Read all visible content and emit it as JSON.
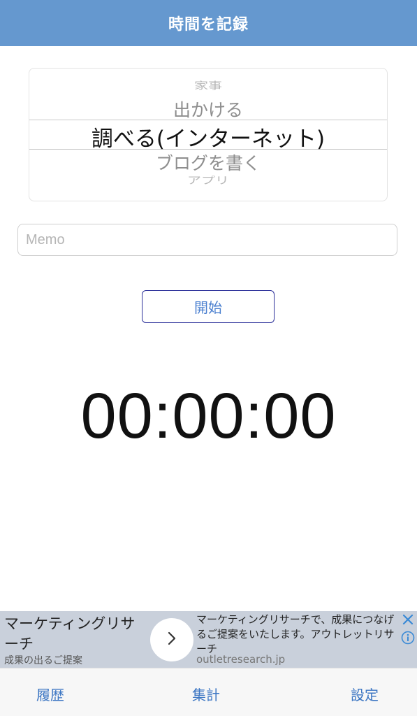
{
  "header": {
    "title": "時間を記録"
  },
  "picker": {
    "items": [
      "家事",
      "出かける",
      "調べる(インターネット)",
      "ブログを書く",
      "アプリ"
    ],
    "selected": "調べる(インターネット)"
  },
  "memo": {
    "placeholder": "Memo",
    "value": ""
  },
  "start_button": {
    "label": "開始"
  },
  "timer": {
    "display": "00:00:00"
  },
  "ad": {
    "headline": "マーケティングリサーチ",
    "subtitle": "成果の出るご提案",
    "body": "マーケティングリサーチで、成果につなげるご提案をいたします。アウトレットリサーチ",
    "domain": "outletresearch.jp",
    "arrow_icon": "chevron-right-icon",
    "close_icon": "close-icon",
    "info_icon": "info-icon"
  },
  "tabs": {
    "history": "履歴",
    "summary": "集計",
    "settings": "設定"
  },
  "colors": {
    "header_bg": "#6598cf",
    "accent": "#3c76c3",
    "start_border": "#2b2f99",
    "ad_bg": "#c9d0db",
    "ad_icon": "#3a8ad6"
  }
}
